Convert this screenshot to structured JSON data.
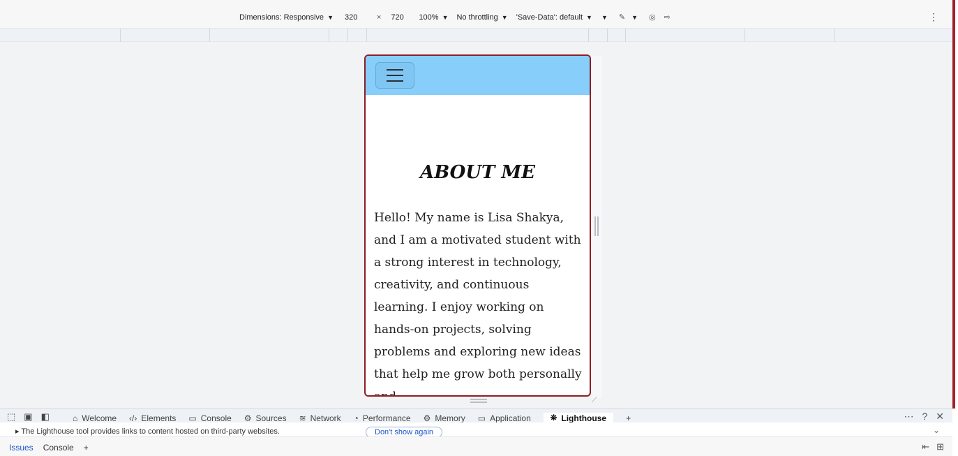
{
  "device_toolbar": {
    "dimensions_label": "Dimensions: Responsive",
    "width_value": "320",
    "times": "×",
    "height_value": "720",
    "zoom": "100%",
    "throttling": "No throttling",
    "save_data": "'Save-Data': default"
  },
  "page": {
    "title": "ABOUT ME",
    "paragraph": "Hello! My name is Lisa Shakya, and I am a motivated student with a strong interest in technology, creativity, and continuous learning. I enjoy working on hands-on projects, solving problems and exploring new ideas that help me grow both personally and"
  },
  "devtools": {
    "tabs": [
      {
        "icon": "⌂",
        "label": "Welcome"
      },
      {
        "icon": "‹/›",
        "label": "Elements"
      },
      {
        "icon": "▭",
        "label": "Console"
      },
      {
        "icon": "⚙",
        "label": "Sources"
      },
      {
        "icon": "≋",
        "label": "Network"
      },
      {
        "icon": "◔",
        "label": "Performance"
      },
      {
        "icon": "⚙",
        "label": "Memory"
      },
      {
        "icon": "▭",
        "label": "Application"
      },
      {
        "icon": "⛯",
        "label": "Lighthouse"
      }
    ],
    "active_tab": "Lighthouse",
    "notice_text": "▸ The Lighthouse tool provides links to content hosted on third-party websites.",
    "notice_button": "Don't show again",
    "drawer_tabs": [
      "Issues",
      "Console"
    ]
  },
  "colors": {
    "header_bg": "#87cefa",
    "frame_border": "#8e1e26",
    "accent_blue": "#1a56c4"
  }
}
